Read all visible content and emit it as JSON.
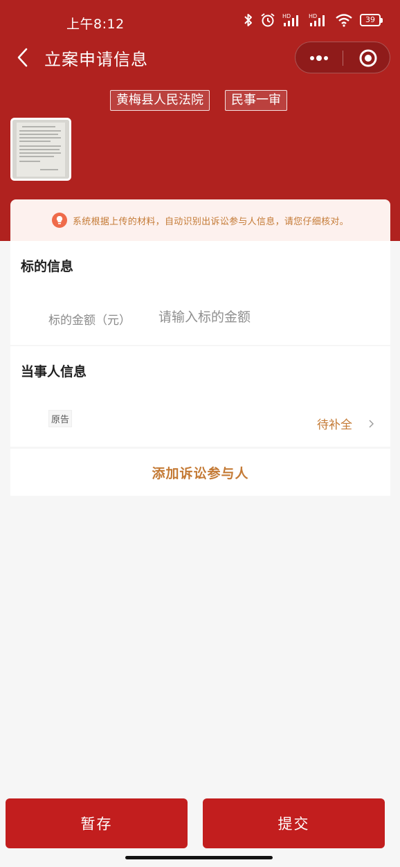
{
  "status_bar": {
    "time": "上午8:12",
    "battery": "39",
    "icons": [
      "bluetooth-icon",
      "alarm-icon",
      "hd-signal-icon",
      "hd-signal-icon",
      "wifi-icon",
      "battery-icon"
    ]
  },
  "nav": {
    "title": "立案申请信息",
    "back_icon": "chevron-left-icon",
    "more_icon": "more-dots-icon",
    "close_icon": "target-circle-icon"
  },
  "tags": {
    "court": "黄梅县人民法院",
    "case_type": "民事一审"
  },
  "notice": {
    "text": "系统根据上传的材料，自动识别出诉讼参与人信息，请您仔细核对。",
    "icon": "lightbulb-icon"
  },
  "subject_section": {
    "title": "标的信息",
    "amount_label": "标的金额（元）",
    "amount_placeholder": "请输入标的金额",
    "amount_value": ""
  },
  "party_section": {
    "title": "当事人信息",
    "parties": [
      {
        "role": "原告",
        "status": "待补全"
      }
    ]
  },
  "add_party_label": "添加诉讼参与人",
  "buttons": {
    "save": "暂存",
    "submit": "提交"
  },
  "colors": {
    "header_bg": "#b0221f",
    "primary_button": "#c21e1e",
    "accent_text": "#c47a35",
    "notice_bg": "#fdf1ee",
    "page_bg": "#f6f6f6"
  }
}
